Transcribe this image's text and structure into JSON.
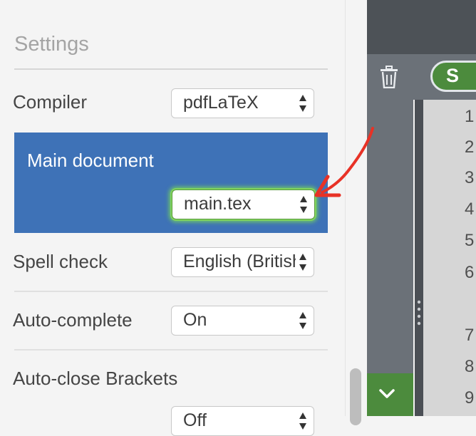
{
  "settings": {
    "title": "Settings",
    "rows": [
      {
        "label": "Compiler",
        "value": "pdfLaTeX"
      },
      {
        "label": "Main document",
        "value": "main.tex"
      },
      {
        "label": "Spell check",
        "value": "English (British)"
      },
      {
        "label": "Auto-complete",
        "value": "On"
      },
      {
        "label": "Auto-close Brackets",
        "value": "Off"
      }
    ]
  },
  "editor": {
    "toggle_label": "S",
    "line_numbers": [
      "1",
      "2",
      "3",
      "4",
      "5",
      "6",
      "7",
      "8",
      "9"
    ]
  },
  "colors": {
    "highlight": "#3e72b7",
    "accent_green": "#4c8b3d",
    "annotation_arrow": "#e83226"
  },
  "icons": [
    "trash-icon",
    "chevron-down-icon",
    "select-arrows-icon",
    "annotation-arrow"
  ]
}
